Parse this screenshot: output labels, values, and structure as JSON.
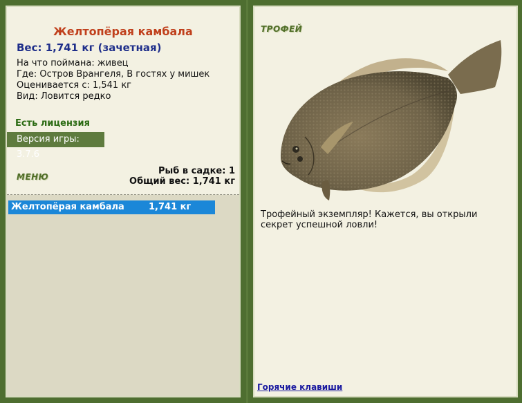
{
  "fish": {
    "name": "Желтопёрая камбала",
    "weight_line": "Вес: 1,741 кг (зачетная)",
    "bait": "На что поймана: живец",
    "location": "Где: Остров Врангеля, В гостях у мишек",
    "scored_from": "Оценивается с: 1,541 кг",
    "rarity": "Вид: Ловится редко"
  },
  "license": "Есть лицензия",
  "version": {
    "label": "Версия игры:",
    "value": "3.7.6"
  },
  "menu_label": "МЕНЮ",
  "keepnet": {
    "count_line": "Рыб в садке: 1",
    "total_line": "Общий вес: 1,741 кг",
    "items": [
      {
        "name": "Желтопёрая камбала",
        "weight": "1,741 кг"
      }
    ]
  },
  "trophy": {
    "label": "ТРОФЕЙ",
    "description": "Трофейный экземпляр! Кажется, вы открыли секрет успешной ловли!"
  },
  "hotkeys_label": "Горячие клавиши",
  "colors": {
    "frame": "#4e6e30",
    "panel": "#f3f1e2",
    "selection": "#1b87d8",
    "title": "#c0401c"
  },
  "icons": {
    "fish_image": "flounder-fish-illustration"
  }
}
